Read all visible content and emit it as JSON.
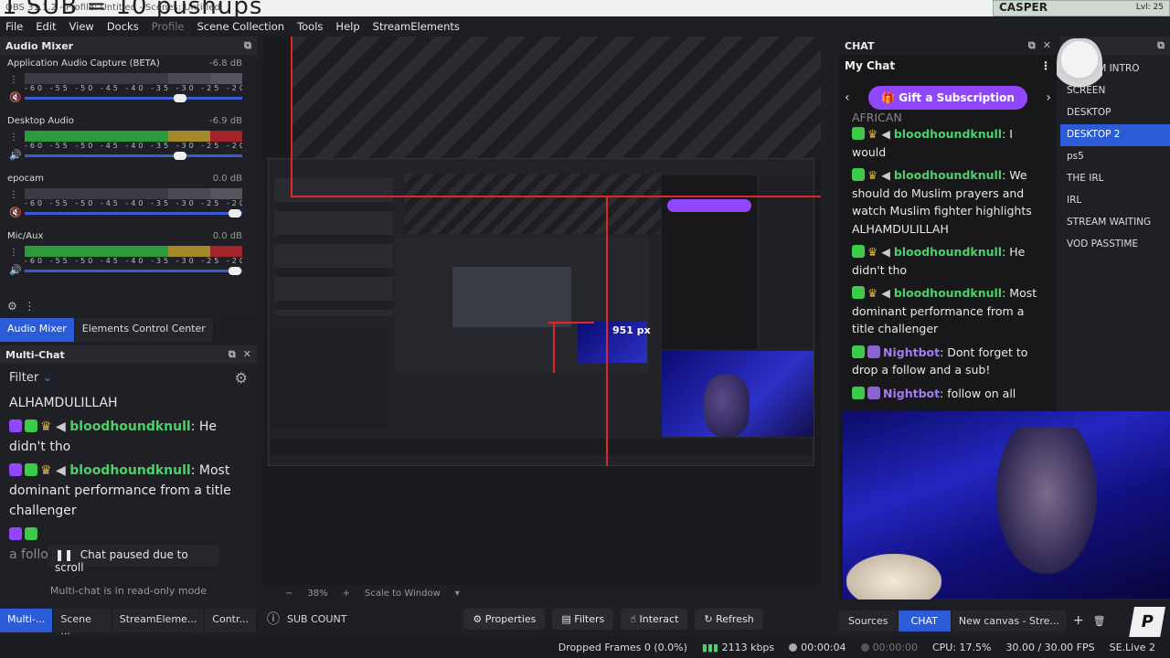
{
  "window": {
    "title": "OBS 31.1.2 - Profile: Untitled - Scenes: Untitled",
    "overlay_title": "1 SUB = 10 pushups",
    "casper_label": "CASPER",
    "casper_level": "Lvl: 25"
  },
  "menu": [
    "File",
    "Edit",
    "View",
    "Docks",
    "Profile",
    "Scene Collection",
    "Tools",
    "Help",
    "StreamElements"
  ],
  "audio_mixer": {
    "title": "Audio Mixer",
    "scale": "-60 -55 -50 -45 -40 -35 -30 -25 -20 -15 -10 -5 0",
    "channels": [
      {
        "name": "Application Audio Capture (BETA)",
        "db": "-6.8 dB",
        "volume": 0.72,
        "muted": true
      },
      {
        "name": "Desktop Audio",
        "db": "-6.9 dB",
        "volume": 0.72,
        "muted": false
      },
      {
        "name": "epocam",
        "db": "0.0 dB",
        "volume": 0.97,
        "muted": true
      },
      {
        "name": "Mic/Aux",
        "db": "0.0 dB",
        "volume": 0.97,
        "muted": false
      }
    ],
    "tabs": [
      "Audio Mixer",
      "Elements Control Center"
    ]
  },
  "multichat": {
    "title": "Multi-Chat",
    "filter": "Filter",
    "top_line": "ALHAMDULILLAH",
    "messages": [
      {
        "user": "bloodhoundknull",
        "text": "He didn't tho"
      },
      {
        "user": "bloodhoundknull",
        "text": "Most dominant performance from a title challenger"
      }
    ],
    "partial_text": "a follow and a sub!",
    "paused": "Chat paused due to scroll",
    "readonly": "Multi-chat is in read-only mode"
  },
  "bottom_tabs": [
    "Multi-...",
    "Scene ...",
    "StreamEleme...",
    "Contr..."
  ],
  "preview": {
    "zoom": "38%",
    "scale_mode": "Scale to Window",
    "source_label": "SUB COUNT",
    "buttons": [
      "Properties",
      "Filters",
      "Interact",
      "Refresh"
    ],
    "nested_px": "951 px"
  },
  "chat": {
    "title": "CHAT",
    "header": "My Chat",
    "gift_button": "Gift a Subscription",
    "cut_top": "AFRICAN",
    "messages": [
      {
        "user": "bloodhoundknull",
        "text": "I would"
      },
      {
        "user": "bloodhoundknull",
        "text": "We should do Muslim prayers and watch Muslim fighter highlights ALHAMDULILLAH"
      },
      {
        "user": "bloodhoundknull",
        "text": "He didn't tho"
      },
      {
        "user": "bloodhoundknull",
        "text": "Most dominant performance from a title challenger"
      },
      {
        "user": "Nightbot",
        "text": "Dont forget to drop a follow and a sub!"
      },
      {
        "user": "Nightbot",
        "text": "follow on all"
      }
    ]
  },
  "scenes": {
    "items": [
      "STREAM INTRO",
      "SCREEN",
      "DESKTOP",
      "DESKTOP 2",
      "ps5",
      "THE IRL",
      "IRL",
      "STREAM WAITING",
      "VOD PASSTIME"
    ],
    "selected": 3
  },
  "right_tabs": [
    "Sources",
    "CHAT",
    "New canvas - Stre..."
  ],
  "status": {
    "dropped": "Dropped Frames 0 (0.0%)",
    "kbps": "2113 kbps",
    "stream_time": "00:00:04",
    "rec_time": "00:00:00",
    "cpu": "CPU: 17.5%",
    "fps": "30.00 / 30.00 FPS",
    "se": "SE.Live 2"
  },
  "colors": {
    "accent": "#2b5bd7",
    "twitch": "#9147ff",
    "green": "#4ecf6b",
    "red": "#e3242b"
  }
}
